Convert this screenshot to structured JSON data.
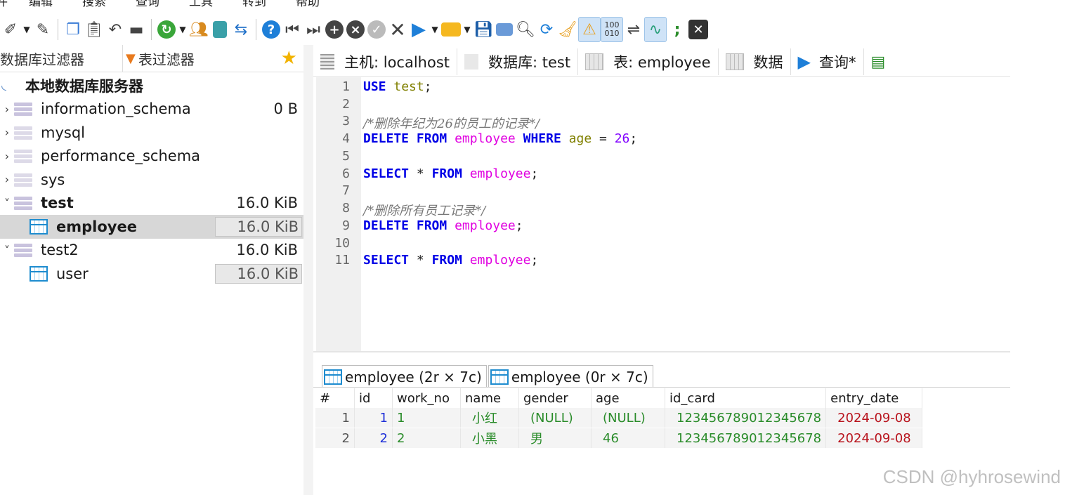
{
  "menu": [
    "件",
    "编辑",
    "搜索",
    "查询",
    "工具",
    "转到",
    "帮助"
  ],
  "left_panel": {
    "db_filter_label": "数据库过滤器",
    "table_filter_label": "表过滤器",
    "server_label": "本地数据库服务器",
    "items": [
      {
        "name": "information_schema",
        "size": "0 B"
      },
      {
        "name": "mysql",
        "size": ""
      },
      {
        "name": "performance_schema",
        "size": ""
      },
      {
        "name": "sys",
        "size": ""
      },
      {
        "name": "test",
        "size": "16.0 KiB"
      },
      {
        "name": "employee",
        "size": "16.0 KiB"
      },
      {
        "name": "test2",
        "size": "16.0 KiB"
      },
      {
        "name": "user",
        "size": "16.0 KiB"
      }
    ]
  },
  "tabs": {
    "host": "主机: localhost",
    "database": "数据库: test",
    "table": "表: employee",
    "data": "数据",
    "query": "查询*"
  },
  "editor": {
    "line_numbers": [
      "1",
      "2",
      "3",
      "4",
      "5",
      "6",
      "7",
      "8",
      "9",
      "10",
      "11"
    ],
    "tokens": {
      "use": "USE",
      "test": "test",
      "semi": ";",
      "comment1": "/*删除年纪为26的员工的记录*/",
      "delete": "DELETE",
      "from": "FROM",
      "employee": "employee",
      "where": "WHERE",
      "age": "age",
      "eq": "=",
      "n26": "26",
      "select": "SELECT",
      "star": "*",
      "comment2": "/*删除所有员工记录*/"
    }
  },
  "results": {
    "tabs": [
      "employee (2r × 7c)",
      "employee (0r × 7c)"
    ],
    "columns": [
      "#",
      "id",
      "work_no",
      "name",
      "gender",
      "age",
      "id_card",
      "entry_date"
    ],
    "rows": [
      {
        "rn": "1",
        "id": "1",
        "work_no": "1",
        "name": "小红",
        "gender": "(NULL)",
        "age": "(NULL)",
        "id_card": "123456789012345678",
        "entry_date": "2024-09-08"
      },
      {
        "rn": "2",
        "id": "2",
        "work_no": "2",
        "name": "小黑",
        "gender": "男",
        "age": "46",
        "id_card": "123456789012345678",
        "entry_date": "2024-09-08"
      }
    ]
  },
  "watermark": "CSDN @hyhrosewind",
  "colors": {
    "keyword": "#0000e6",
    "identifier": "#e000e0",
    "column": "#808000",
    "number": "#8000ff",
    "accent": "#1e7fd8"
  }
}
